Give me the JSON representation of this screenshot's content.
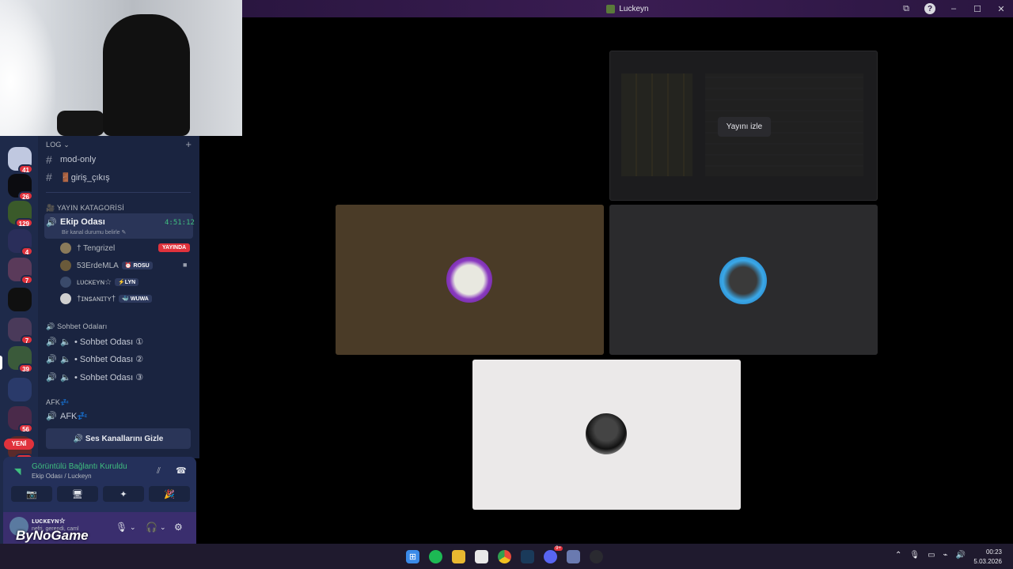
{
  "window": {
    "title": "Luckeyn",
    "help": "?",
    "minimize": "–",
    "maximize": "☐",
    "close": "✕",
    "popout": "⧉"
  },
  "rail": {
    "badges": [
      "41",
      "26",
      "129",
      "4",
      "7",
      "7",
      "39",
      "56",
      "516"
    ],
    "new_label": "YENİ"
  },
  "channels": {
    "log_category": "LOG",
    "text_channels": [
      "mod-only",
      "🚪giriş_çıkış"
    ],
    "stream_category": "🎥 YAYIN KATAGORİSİ",
    "active_channel": {
      "name": "Ekip Odası",
      "timer": "4:51:12",
      "status": "Bir kanal durumu belirle ✎"
    },
    "users": [
      {
        "name": "† Tengrizel",
        "tag": ""
      },
      {
        "name": "53ErdeMLA",
        "tag": "⏰ ROSU"
      },
      {
        "name": "ʟᴜᴄᴋᴇʏɴ☆",
        "tag": "⚡LYN"
      },
      {
        "name": "†ɪɴꜱᴀɴɪᴛʏ†",
        "tag": "🐳 WUWA"
      }
    ],
    "live_label": "YAYINDA",
    "chat_category": "🔊 Sohbet Odaları",
    "chat_rooms": [
      "• Sohbet Odası ①",
      "• Sohbet Odası ②",
      "• Sohbet Odası ③"
    ],
    "afk_category": "AFK💤",
    "afk_channel": "AFK💤",
    "hide_button": "🔊 Ses Kanallarını Gizle"
  },
  "voice": {
    "status": "Görüntülü Bağlantı Kuruldu",
    "location": "Ekip Odası / Luckeyn",
    "buttons": [
      "📷",
      "🖥",
      "✦",
      "🎉"
    ]
  },
  "user": {
    "name": "ʟᴜᴄᴋᴇʏɴ☆",
    "status": "nefri, gerendi, caml",
    "mic": "🎙",
    "headset": "🎧",
    "settings": "⚙"
  },
  "watermark": "ByNoGame",
  "stage": {
    "watch_label": "Yayını izle"
  },
  "taskbar": {
    "time": "00:23",
    "date": "5.03.2026",
    "discord_badge": "9+"
  },
  "colors": {
    "accent_green": "#3fbf7f",
    "live_red": "#e0323c",
    "rail_bg": "#1e2a4a",
    "channels_bg": "#1a2440"
  }
}
